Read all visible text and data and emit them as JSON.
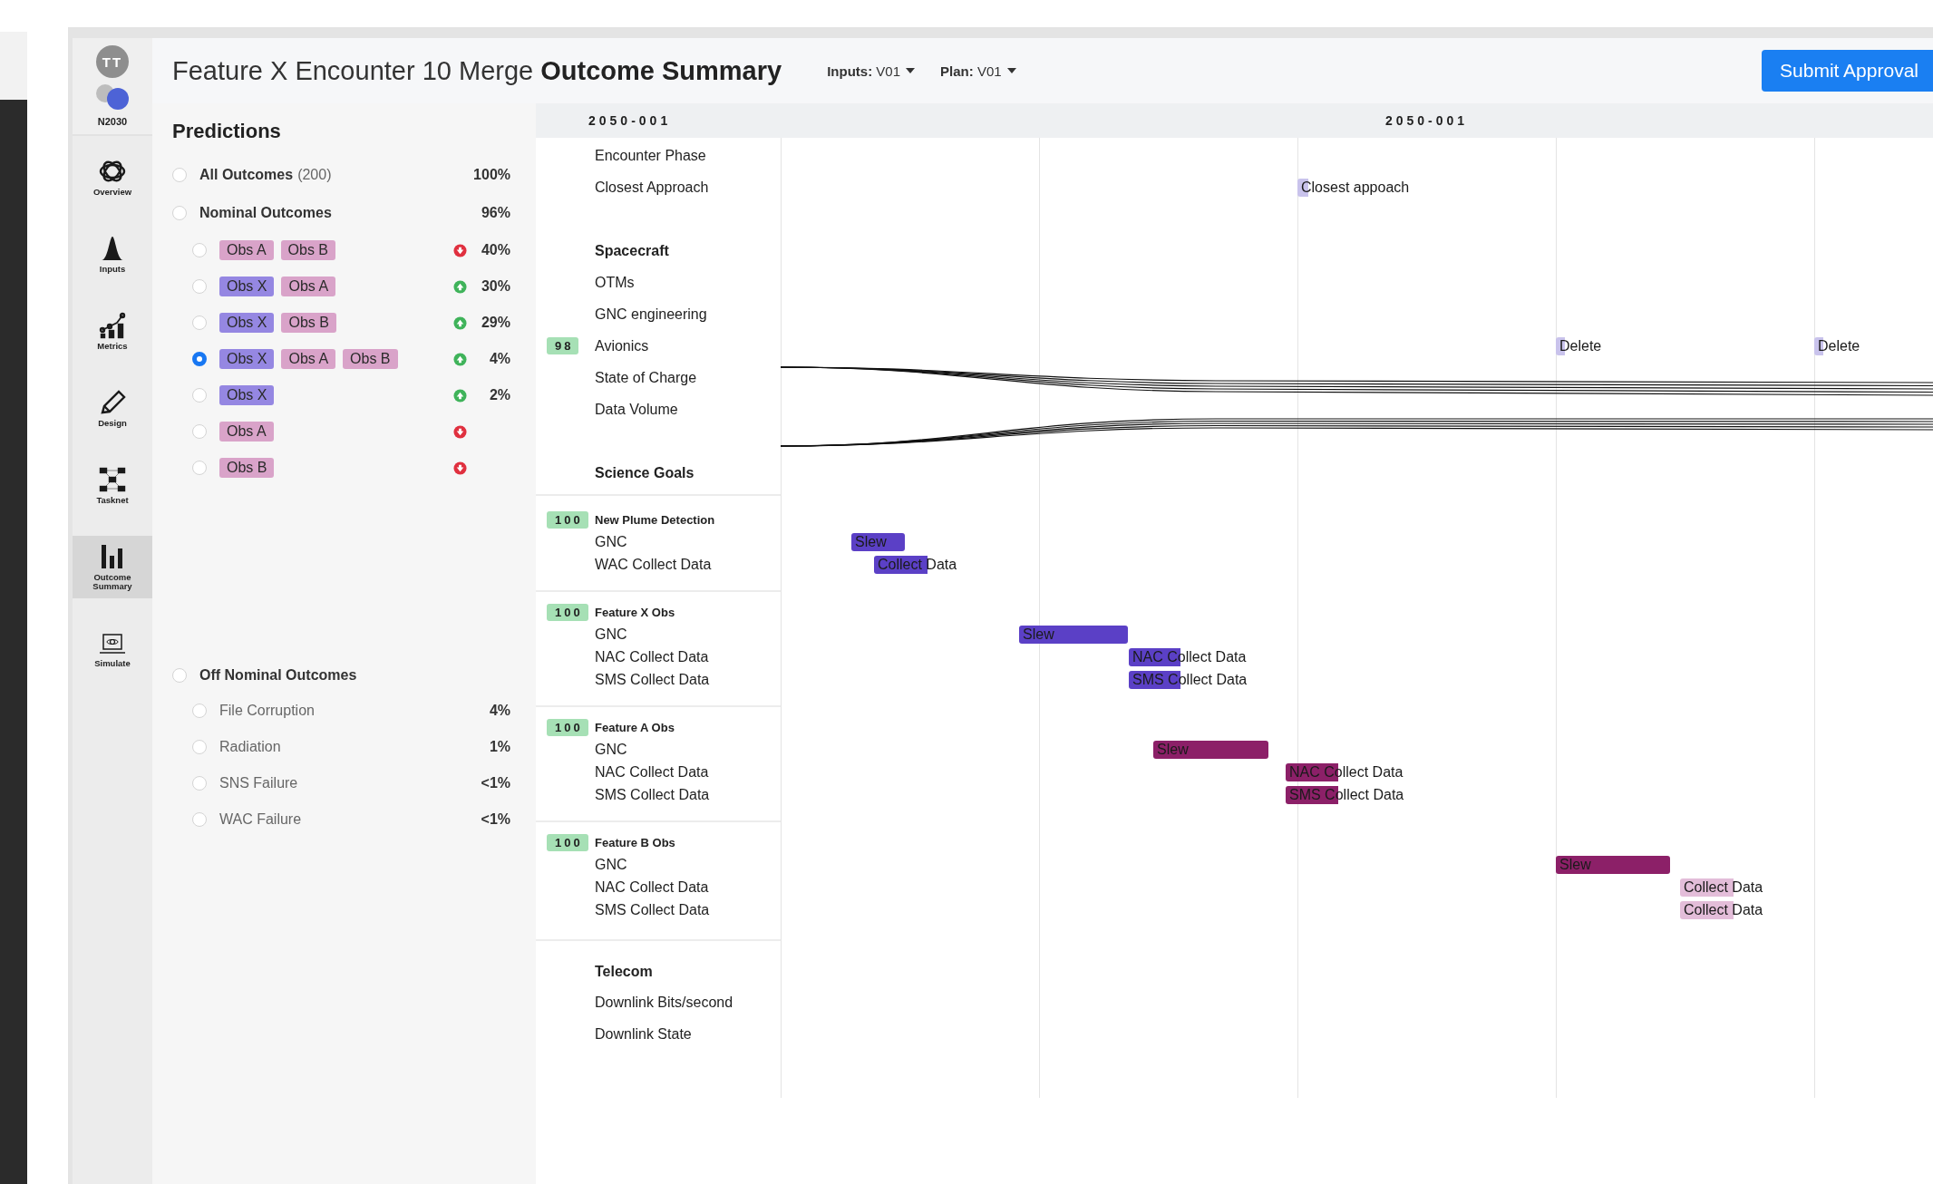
{
  "nav": {
    "avatar": "TT",
    "brand": "N2030",
    "items": [
      {
        "label": "Overview",
        "selected": false
      },
      {
        "label": "Inputs",
        "selected": false
      },
      {
        "label": "Metrics",
        "selected": false
      },
      {
        "label": "Design",
        "selected": false
      },
      {
        "label": "Tasknet",
        "selected": false
      },
      {
        "label": "Outcome Summary",
        "selected": true
      },
      {
        "label": "Simulate",
        "selected": false
      }
    ]
  },
  "header": {
    "title": "Feature X Encounter 10 Merge **Outcome Summary**",
    "dropdowns": [
      {
        "label": "Inputs:",
        "value": "V01"
      },
      {
        "label": "Plan:",
        "value": "V01"
      }
    ],
    "submit": "Submit Approval"
  },
  "predictions": {
    "title": "Predictions",
    "outcomes": [
      {
        "label": "All Outcomes",
        "count": "(200)",
        "percent": "100%",
        "selected": false
      },
      {
        "label": "Nominal Outcomes",
        "percent": "96%",
        "selected": false,
        "children": [
          {
            "tags": [
              {
                "text": "Obs A",
                "color": "#d9a3c9"
              },
              {
                "text": "Obs B",
                "color": "#d9a3c9"
              }
            ],
            "rising": false,
            "percent": "40%",
            "selected": false
          },
          {
            "tags": [
              {
                "text": "Obs X",
                "color": "#9587e2"
              },
              {
                "text": "Obs A",
                "color": "#d9a3c9"
              }
            ],
            "rising": true,
            "percent": "30%",
            "selected": false
          },
          {
            "tags": [
              {
                "text": "Obs X",
                "color": "#9587e2"
              },
              {
                "text": "Obs B",
                "color": "#d9a3c9"
              }
            ],
            "rising": true,
            "percent": "29%",
            "selected": false
          },
          {
            "tags": [
              {
                "text": "Obs X",
                "color": "#9587e2"
              },
              {
                "text": "Obs A",
                "color": "#d9a3c9"
              },
              {
                "text": "Obs B",
                "color": "#d9a3c9"
              }
            ],
            "rising": true,
            "percent": "4%",
            "selected": true
          },
          {
            "tags": [
              {
                "text": "Obs X",
                "color": "#9587e2"
              }
            ],
            "rising": true,
            "percent": "2%",
            "selected": false
          },
          {
            "tags": [
              {
                "text": "Obs A",
                "color": "#d9a3c9"
              }
            ],
            "rising": false,
            "selected": false
          },
          {
            "tags": [
              {
                "text": "Obs B",
                "color": "#d9a3c9"
              }
            ],
            "rising": false,
            "selected": false
          }
        ]
      }
    ],
    "off_nominal": {
      "label": "Off Nominal Outcomes",
      "selected": false,
      "children": [
        {
          "label": "File Corruption",
          "percent": "4%",
          "selected": false
        },
        {
          "label": "Radiation",
          "percent": "1%",
          "selected": false
        },
        {
          "label": "SNS Failure",
          "percent": "<1%",
          "selected": false
        },
        {
          "label": "WAC Failure",
          "percent": "<1%",
          "selected": false
        }
      ]
    }
  },
  "timeline": {
    "date_left": "2050-001",
    "date_center": "2050-001",
    "rows": [
      {
        "kind": "item",
        "label": "Encounter Phase"
      },
      {
        "kind": "item",
        "label": "Closest Approach",
        "events": [
          {
            "label": "Closest appoach",
            "color": "#c9c3ec"
          }
        ]
      },
      {
        "kind": "section",
        "label": "Spacecraft"
      },
      {
        "kind": "item",
        "label": "OTMs"
      },
      {
        "kind": "item",
        "label": "GNC engineering"
      },
      {
        "kind": "item",
        "label": "Avionics",
        "badge": "98",
        "events": [
          {
            "label": "Delete",
            "color": "#c9c3ec"
          },
          {
            "label": "Delete",
            "color": "#c9c3ec"
          }
        ]
      },
      {
        "kind": "item",
        "label": "State of Charge"
      },
      {
        "kind": "item",
        "label": "Data Volume"
      },
      {
        "kind": "section",
        "label": "Science Goals"
      },
      {
        "kind": "group",
        "label": "New Plume Detection",
        "badge": "100"
      },
      {
        "kind": "item",
        "label": "GNC",
        "events": [
          {
            "label": "Slew",
            "color": "#5b40c6"
          }
        ]
      },
      {
        "kind": "item",
        "label": "WAC Collect Data",
        "events": [
          {
            "label": "Collect Data",
            "color": "#5b40c6"
          }
        ]
      },
      {
        "kind": "group",
        "label": "Feature X Obs",
        "badge": "100"
      },
      {
        "kind": "item",
        "label": "GNC",
        "events": [
          {
            "label": "Slew",
            "color": "#5b40c6"
          }
        ]
      },
      {
        "kind": "item",
        "label": "NAC Collect Data",
        "events": [
          {
            "label": "NAC Collect Data",
            "color": "#5b40c6"
          }
        ]
      },
      {
        "kind": "item",
        "label": "SMS Collect Data",
        "events": [
          {
            "label": "SMS Collect Data",
            "color": "#5b40c6"
          }
        ]
      },
      {
        "kind": "group",
        "label": "Feature A Obs",
        "badge": "100"
      },
      {
        "kind": "item",
        "label": "GNC",
        "events": [
          {
            "label": "Slew",
            "color": "#8c2068"
          }
        ]
      },
      {
        "kind": "item",
        "label": "NAC Collect Data",
        "events": [
          {
            "label": "NAC Collect Data",
            "color": "#8c2068"
          }
        ]
      },
      {
        "kind": "item",
        "label": "SMS Collect Data",
        "events": [
          {
            "label": "SMS Collect Data",
            "color": "#8c2068"
          }
        ]
      },
      {
        "kind": "group",
        "label": "Feature B Obs",
        "badge": "100"
      },
      {
        "kind": "item",
        "label": "GNC",
        "events": [
          {
            "label": "Slew",
            "color": "#8c2068"
          }
        ]
      },
      {
        "kind": "item",
        "label": "NAC Collect Data",
        "events": [
          {
            "label": "Collect Data",
            "color": "#e3bdd9"
          }
        ]
      },
      {
        "kind": "item",
        "label": "SMS Collect Data",
        "events": [
          {
            "label": "Collect Data",
            "color": "#e3bdd9"
          }
        ]
      },
      {
        "kind": "section",
        "label": "Telecom"
      },
      {
        "kind": "item",
        "label": "Downlink Bits/second"
      },
      {
        "kind": "item",
        "label": "Downlink State"
      }
    ]
  }
}
